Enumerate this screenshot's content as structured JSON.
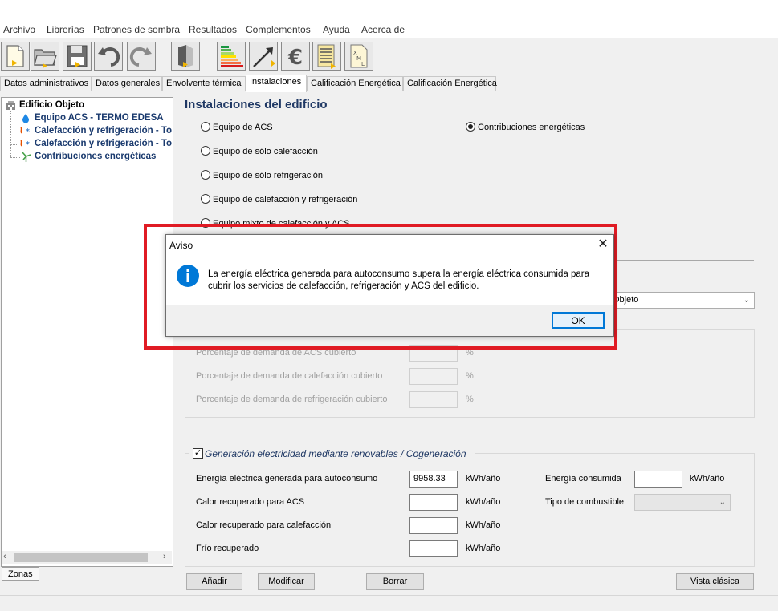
{
  "menu": [
    "Archivo",
    "Librerías",
    "Patrones de sombra",
    "Resultados",
    "Complementos",
    "Ayuda",
    "Acerca de"
  ],
  "tabs": [
    "Datos administrativos",
    "Datos generales",
    "Envolvente térmica",
    "Instalaciones",
    "Calificación Energética",
    "Calificación Energética"
  ],
  "active_tab": "Instalaciones",
  "tree": {
    "root": "Edificio Objeto",
    "items": [
      "Equipo ACS - TERMO EDESA",
      "Calefacción y refrigeración - To",
      "Calefacción y refrigeración - To",
      "Contribuciones energéticas"
    ],
    "bottom_tab": "Zonas"
  },
  "main": {
    "title": "Instalaciones del edificio",
    "radios": {
      "acs": "Equipo de ACS",
      "solo_calefaccion": "Equipo de sólo calefacción",
      "solo_refrigeracion": "Equipo de sólo refrigeración",
      "calef_refrig": "Equipo de calefacción y refrigeración",
      "mixto": "Equipo mixto de calefacción y ACS",
      "contribuciones": "Contribuciones energéticas"
    },
    "selected_radio": "Contribuciones energéticas",
    "combo_zone_value": "Objeto",
    "demand": {
      "acs": "Porcentaje de demanda de ACS cubierto",
      "calefaccion": "Porcentaje de demanda de calefacción cubierto",
      "refrigeracion": "Porcentaje de demanda de refrigeración cubierto",
      "unit": "%"
    },
    "renewables": {
      "checked": true,
      "title": "Generación electricidad mediante renovables / Cogeneración",
      "energia_label": "Energía eléctrica generada para autoconsumo",
      "energia_value": "9958.33",
      "calor_acs_label": "Calor recuperado para ACS",
      "calor_calef_label": "Calor recuperado para calefacción",
      "frio_label": "Frío recuperado",
      "unit": "kWh/año",
      "consumida_label": "Energía consumida",
      "combustible_label": "Tipo de combustible"
    },
    "buttons": {
      "anadir": "Añadir",
      "modificar": "Modificar",
      "borrar": "Borrar",
      "vista": "Vista clásica"
    }
  },
  "dialog": {
    "title": "Aviso",
    "message_line1": "La energía eléctrica generada para autoconsumo supera la energía eléctrica consumida para",
    "message_line2": "cubrir los servicios de calefacción, refrigeración y ACS del edificio.",
    "ok": "OK"
  },
  "colors": {
    "title_blue": "#1f3864",
    "tree_blue": "#1a3a6e",
    "highlight_red": "#e01b24",
    "info_blue": "#0078d7"
  },
  "icons": [
    "new-file-icon",
    "open-folder-icon",
    "save-icon",
    "undo-icon",
    "redo-icon",
    "building-icon",
    "energy-rating-icon",
    "arrow-chart-icon",
    "euro-icon",
    "document-icon",
    "xml-icon",
    "info-icon",
    "close-icon"
  ]
}
